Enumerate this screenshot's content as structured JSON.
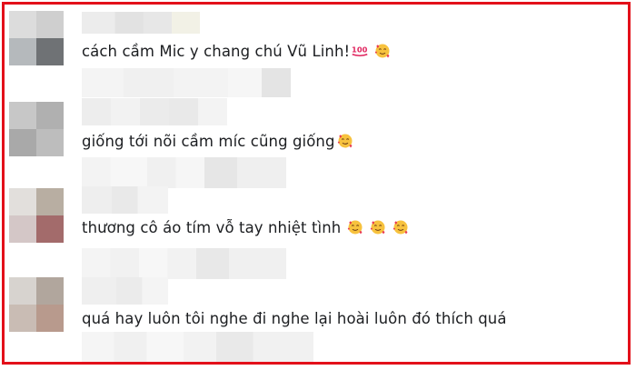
{
  "colors": {
    "border": "#e3101a",
    "text": "#1c1e21"
  },
  "comments": [
    {
      "text": "cách cầm Mic y chang chú Vũ Linh!",
      "emojis": [
        "hundred-points-icon",
        "smiling-face-with-hearts-icon"
      ]
    },
    {
      "text": "giống tới nõi cầm míc cũng giống",
      "emojis": [
        "smiling-face-with-hearts-icon"
      ]
    },
    {
      "text": "thương cô áo tím vỗ tay nhiệt tình",
      "emojis": [
        "smiling-face-with-hearts-icon",
        "smiling-face-with-hearts-icon",
        "smiling-face-with-hearts-icon"
      ]
    },
    {
      "text": "quá hay luôn tôi nghe đi nghe lại hoài luôn đó thích quá",
      "emojis": []
    }
  ]
}
